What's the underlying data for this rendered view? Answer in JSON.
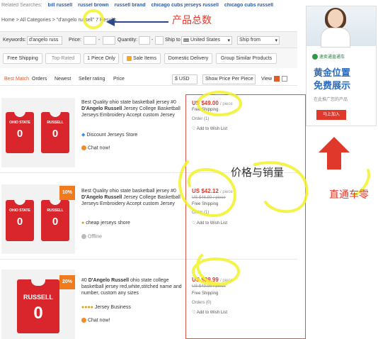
{
  "related": {
    "label": "Related Searches:",
    "items": [
      "bill russell",
      "russel brown",
      "russell brand",
      "chicago cubs jerseys russell",
      "chicago cubs russell"
    ]
  },
  "breadcrumb": "Home > All Categories > \"d'angelo russell\" 7 Results",
  "filters": {
    "keywords_label": "Keywords:",
    "keywords_value": "d'angelo russ",
    "price_label": "Price:",
    "price_sep": "-",
    "quantity_label": "Quantity:",
    "quantity_sep": "-",
    "shipto_label": "Ship to",
    "shipto_value": "United States",
    "shipfrom_value": "Ship from"
  },
  "chips": [
    "Free Shipping",
    "Top-Rated",
    "1 Piece Only",
    "Sale Items",
    "Domestic Delivery",
    "Group Similar Products"
  ],
  "sort": {
    "best_match": "Best Match",
    "orders": "Orders",
    "newest": "Newest",
    "seller_rating": "Seller rating",
    "price": "Price",
    "currency": "$ USD",
    "show_price": "Show Price Per Piece",
    "view": "View"
  },
  "products": [
    {
      "title_pre": "Best Quality ohio state basketball jersey #0 ",
      "title_bold": "D'Angelo Russell",
      "title_post": " Jersey College Basketball Jerseys Embroidery Accept custom Jersey",
      "store": "Discount Jerseys Store",
      "chat": "Chat now!",
      "price": "US $49.00",
      "unit": "/ piece",
      "old_price": "",
      "shipping": "Free Shipping",
      "orders": "Order (1)",
      "wish": "Add to Wish List",
      "badge": "",
      "jersey_a": {
        "word": "OHIO STATE",
        "num": "0"
      },
      "jersey_b": {
        "word": "RUSSELL",
        "num": "0"
      }
    },
    {
      "title_pre": "Best Quality ohio state basketball jersey #0 ",
      "title_bold": "D'Angelo Russell",
      "title_post": " Jersey College Basketball Jerseys Embroidery Accept custom Jersey",
      "store": "cheap jerseys shore",
      "chat": "Offline",
      "price": "US $42.12",
      "unit": "/ piece",
      "old_price": "US $46.80 / piece",
      "shipping": "Free Shipping",
      "orders": "Order (1)",
      "wish": "Add to Wish List",
      "badge": "10%",
      "jersey_a": {
        "word": "OHIO STATE",
        "num": "0"
      },
      "jersey_b": {
        "word": "RUSSELL",
        "num": "0"
      }
    },
    {
      "title_pre": "#0 ",
      "title_bold": "D'Angelo Russell",
      "title_post": " ohio state college basketball jersey red,white,stitched name and number, custom any sizes",
      "store": "Jersey Business",
      "chat": "Chat now!",
      "price": "US $39.99",
      "unit": "/ piece",
      "old_price": "US $49.99 / piece",
      "shipping": "Free Shipping",
      "orders": "Orders (0)",
      "wish": "Add to Wish List",
      "badge": "20%",
      "jersey_a": {
        "word": "RUSSELL",
        "num": "0"
      }
    }
  ],
  "ad": {
    "brand": "速卖通直通车",
    "headline1": "黄金位置",
    "headline2": "免费展示",
    "sub": "在此推广您的产品",
    "button": "马上加入"
  },
  "annotations": {
    "total_count": "产品总数",
    "price_sales": "价格与销量",
    "through_train": "直通车零",
    "colors": {
      "red": "#e0392b",
      "yellow": "#f5f52a"
    }
  }
}
